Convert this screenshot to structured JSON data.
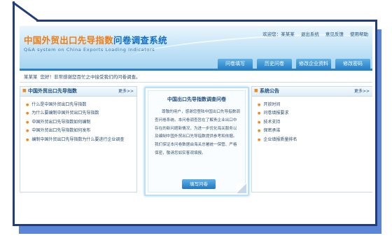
{
  "header": {
    "title_cn": "中国外贸出口先导指数",
    "title_highlight": "问卷调查系统",
    "subtitle_en": "Q&A system on China Exports Loading Indicators",
    "top_links": [
      "欢迎您：某某某",
      "退出系统",
      "意见反馈",
      "使用帮助"
    ]
  },
  "nav": [
    "问卷填写",
    "历史问卷",
    "修改企业资料",
    "修改密码"
  ],
  "welcome": {
    "user": "某某某",
    "message": "您好！非常感谢您百忙之中接受我们的问卷调查。"
  },
  "left_panel": {
    "title": "中国外贸出口先导指数",
    "more": "更多>>",
    "items": [
      "什么是中国外贸出口先导指数",
      "为什么要编制中国外贸出口先导指数",
      "中国外贸出口先导指数如何编制",
      "中国外贸出口先导指数如何发布",
      "编制中国外贸出口先导指数为什么要进行企业调查"
    ]
  },
  "center_panel": {
    "title": "中国出口先导指数调查问卷",
    "body": "尊敬的用户，感谢您登陆中国出口先导指数调查问卷系统。本问卷调查旨在了解贵企业出口中存在的新问题新情况，为进一步优化海关服务以及编制中国外贸出口先导指数提供参考和依据。我们保证本问卷数据由海关总署统一保管、严格保密，敬请您如实客观填报。",
    "button": "填写问卷"
  },
  "right_panel": {
    "title": "系统公告",
    "more": "更多>>",
    "items": [
      "开放时间",
      "问卷填报要求",
      "技术支持",
      "保密承诺",
      "企业填报质量排名"
    ]
  },
  "colors": {
    "frame": "#223d78",
    "shadow": "#5b86d8",
    "accent_orange": "#f07c12",
    "nav_blue": "#2a83c8"
  }
}
